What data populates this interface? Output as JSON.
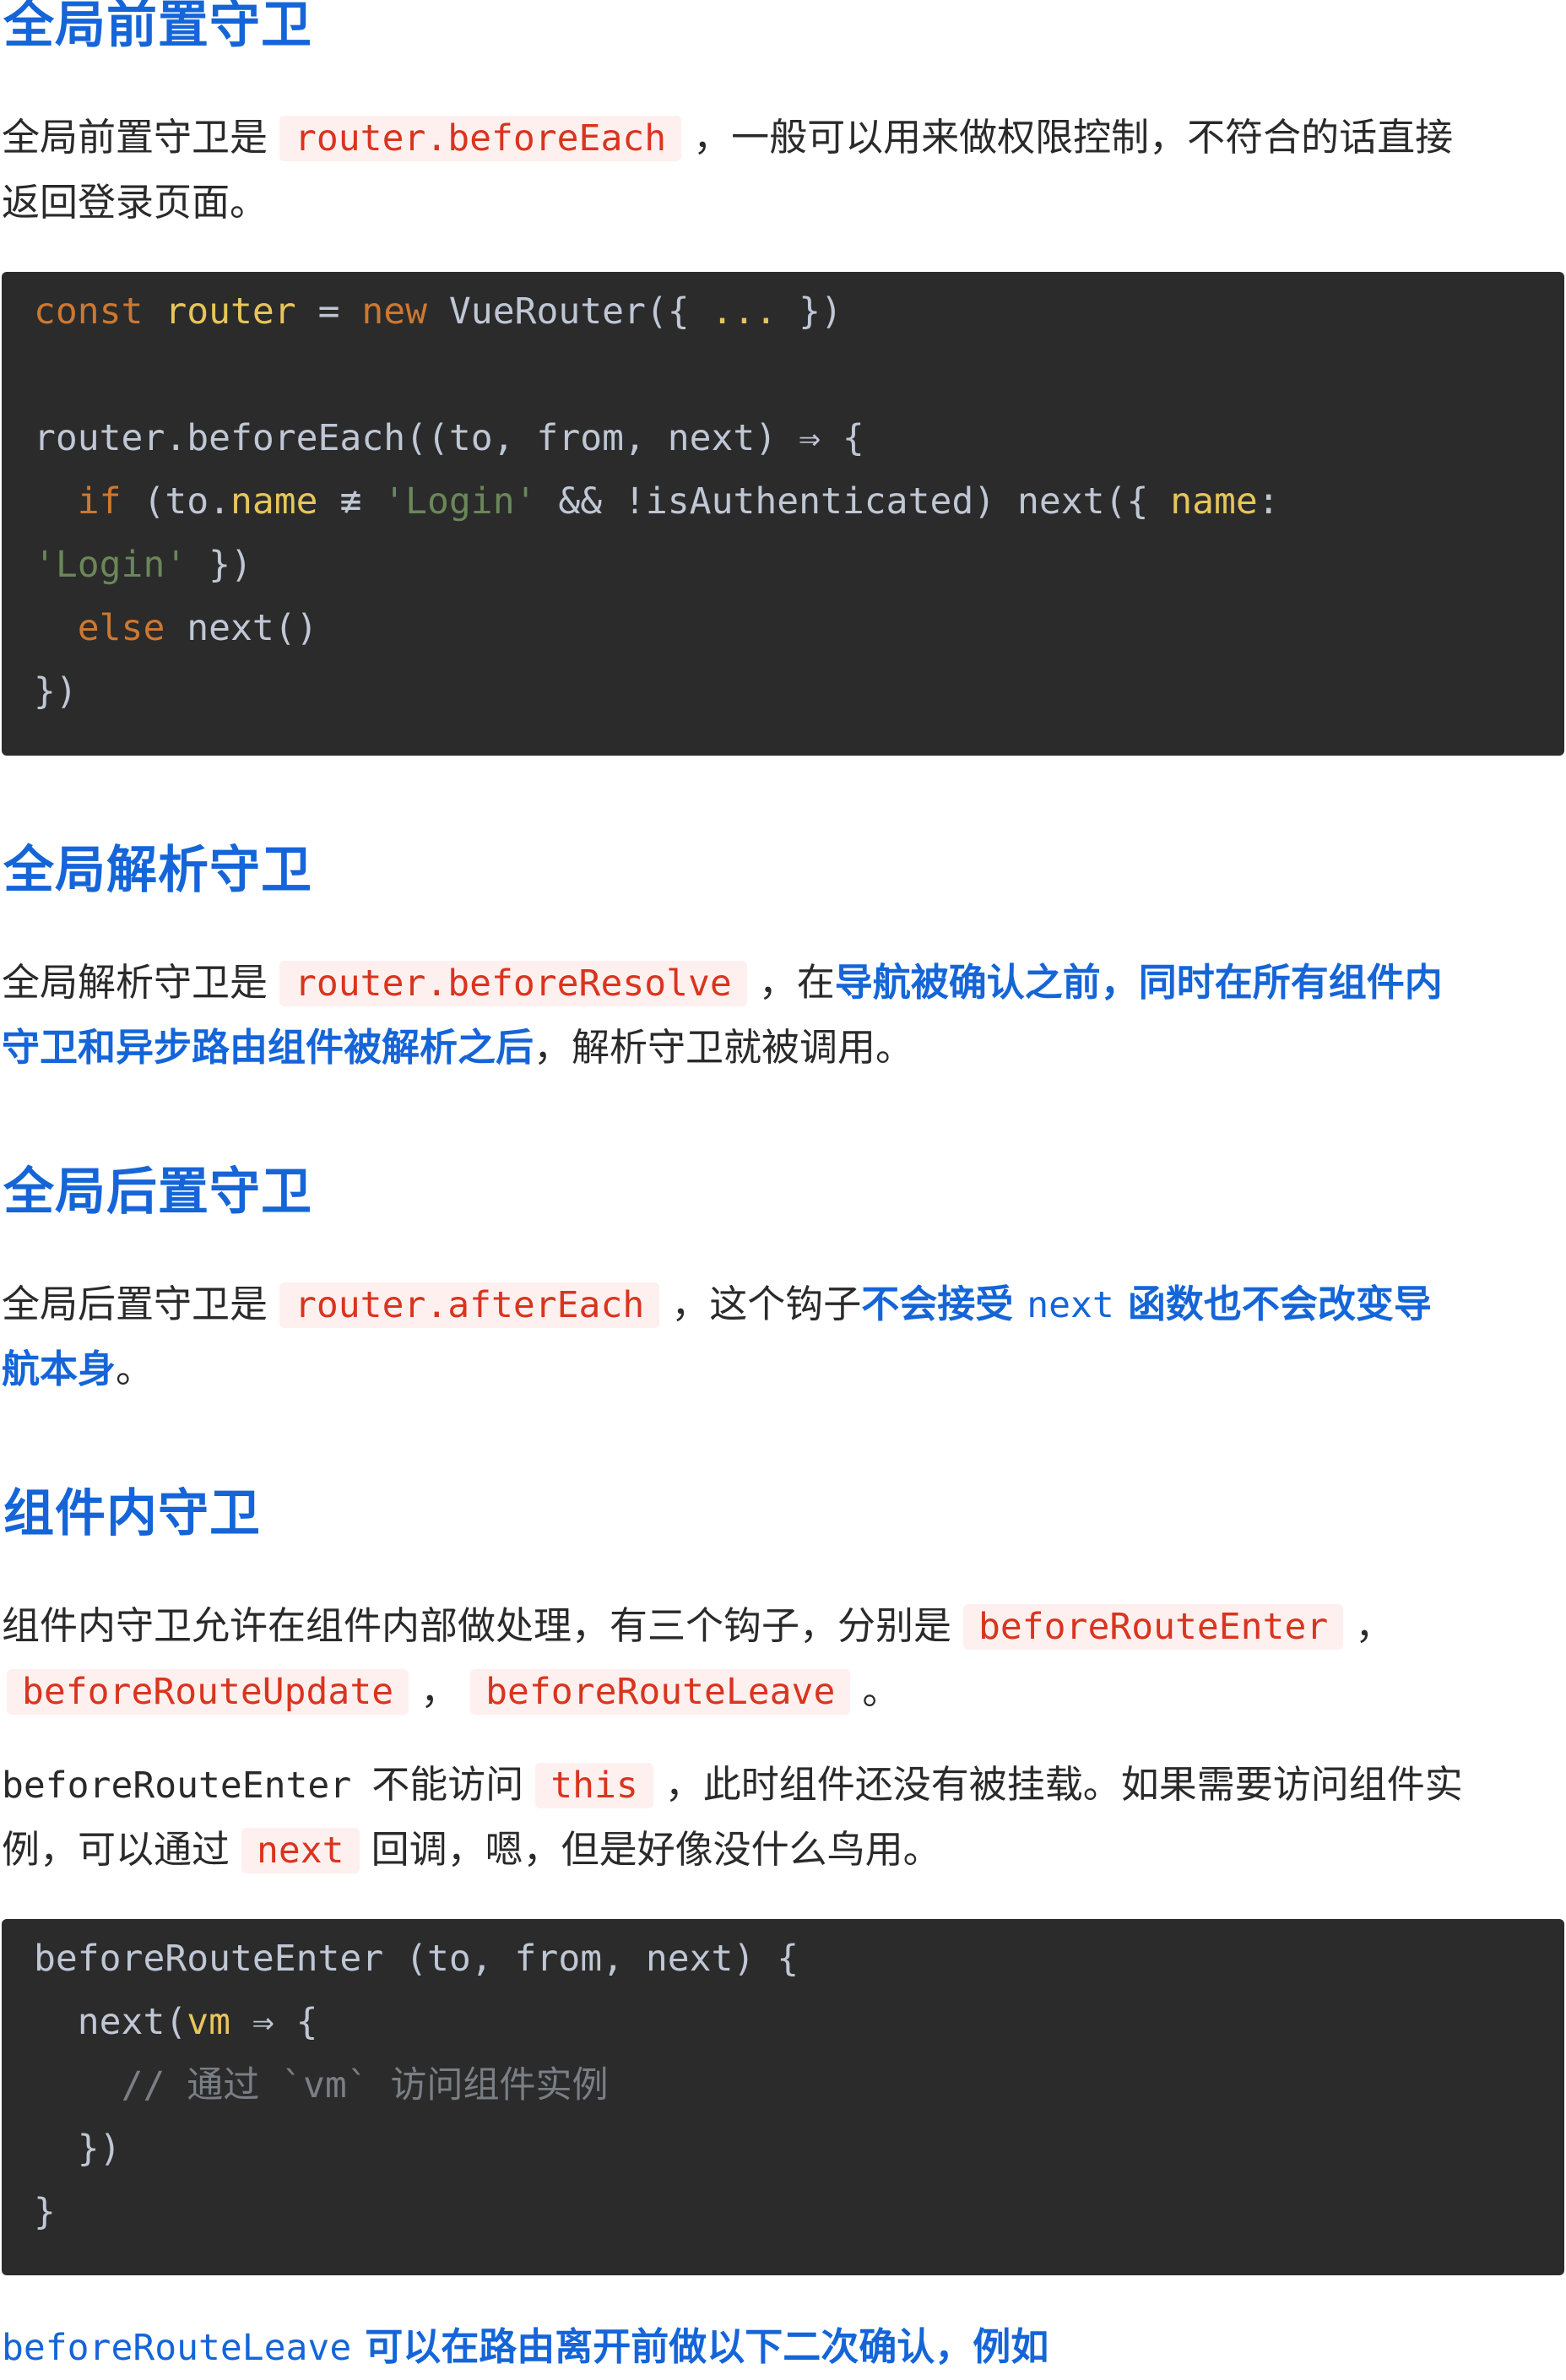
{
  "s1": {
    "heading": "全局前置守卫",
    "t1": "全局前置守卫是",
    "c1": "router.beforeEach",
    "t2": "，一般可以用来做权限控制，不符合的话直接",
    "t3": "返回登录页面。"
  },
  "code1": {
    "l1": [
      "const",
      " ",
      "router",
      " = ",
      "new",
      " VueRouter({ ",
      "...",
      " })"
    ],
    "l3": "router.beforeEach((to, from, next) ⇒ {",
    "l4": [
      "if",
      " (to.",
      "name",
      " ≢ ",
      "'Login'",
      " && !isAuthenticated) next({ ",
      "name",
      ":"
    ],
    "l5": [
      "'Login'",
      " })"
    ],
    "l6": [
      "else",
      " next()"
    ],
    "l7": "})"
  },
  "s2": {
    "heading": "全局解析守卫",
    "t1": "全局解析守卫是",
    "c1": "router.beforeResolve",
    "t2": "，在",
    "b1": "导航被确认之前，同时在所有组件内",
    "b2": "守卫和异步路由组件被解析之后",
    "t3": "，解析守卫就被调用。"
  },
  "s3": {
    "heading": "全局后置守卫",
    "t1": "全局后置守卫是",
    "c1": "router.afterEach",
    "t2": "，这个钩子",
    "b1": "不会接受",
    "m1": "next",
    "b2": "函数也不会改变导",
    "b3": "航本身",
    "t3": "。"
  },
  "s4": {
    "heading": "组件内守卫",
    "t1": "组件内守卫允许在组件内部做处理，有三个钩子，分别是",
    "c1": "beforeRouteEnter",
    "t2": "，",
    "c2": "beforeRouteUpdate",
    "t3": "，",
    "c3": "beforeRouteLeave",
    "t4": "。",
    "p2_m1": "beforeRouteEnter",
    "p2_t1": "不能访问",
    "p2_c1": "this",
    "p2_t2": "，此时组件还没有被挂载。如果需要访问组件实",
    "p2_t3": "例，可以通过",
    "p2_c2": "next",
    "p2_t4": "回调，嗯，但是好像没什么鸟用。"
  },
  "code2": {
    "l1": "beforeRouteEnter (to, from, next) {",
    "l2": [
      "next(",
      "vm",
      " ⇒ {"
    ],
    "l3": "// 通过 `vm` 访问组件实例",
    "l4": "})",
    "l5": "}"
  },
  "s5": {
    "m1": "beforeRouteLeave",
    "b1": "可以在路由离开前做以下二次确认，例如"
  }
}
